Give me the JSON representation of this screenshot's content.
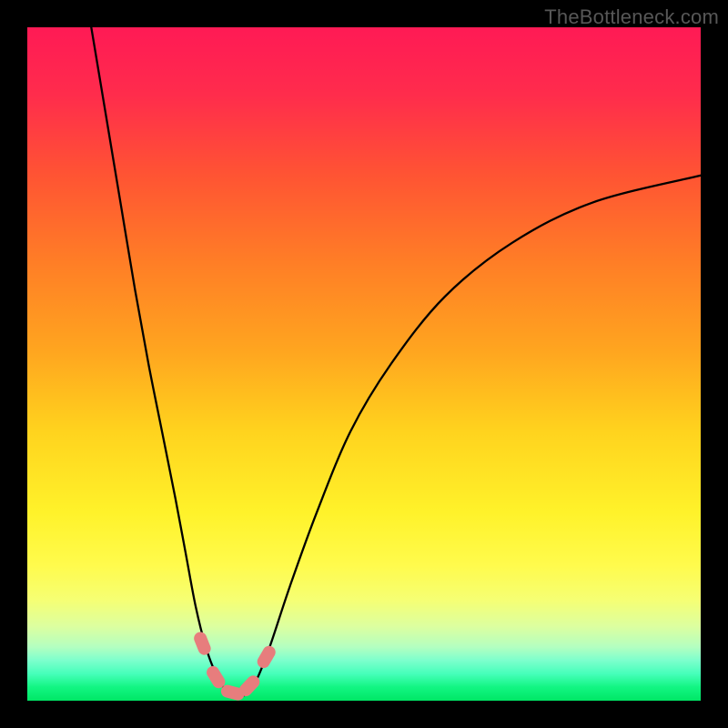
{
  "watermark": "TheBottleneck.com",
  "frame": {
    "inner_width": 740,
    "inner_height": 740,
    "border": 30
  },
  "gradient": {
    "stops": [
      {
        "pct": 0,
        "color": "#ff1a55"
      },
      {
        "pct": 10,
        "color": "#ff2c4c"
      },
      {
        "pct": 22,
        "color": "#ff5433"
      },
      {
        "pct": 35,
        "color": "#ff7e26"
      },
      {
        "pct": 48,
        "color": "#ffa51f"
      },
      {
        "pct": 60,
        "color": "#ffd31e"
      },
      {
        "pct": 72,
        "color": "#fff22a"
      },
      {
        "pct": 80,
        "color": "#fffb4d"
      },
      {
        "pct": 85,
        "color": "#f6ff73"
      },
      {
        "pct": 89,
        "color": "#dcffa0"
      },
      {
        "pct": 92,
        "color": "#b4ffc0"
      },
      {
        "pct": 94,
        "color": "#7dffcd"
      },
      {
        "pct": 96,
        "color": "#46ffba"
      },
      {
        "pct": 98,
        "color": "#12f582"
      },
      {
        "pct": 100,
        "color": "#00e765"
      }
    ]
  },
  "chart_data": {
    "type": "line",
    "title": "",
    "xlabel": "",
    "ylabel": "",
    "xlim": [
      0,
      100
    ],
    "ylim": [
      0,
      100
    ],
    "curve": {
      "points": [
        [
          9.5,
          100
        ],
        [
          12,
          85
        ],
        [
          14,
          73
        ],
        [
          16,
          61
        ],
        [
          18,
          50
        ],
        [
          20,
          40
        ],
        [
          22,
          30
        ],
        [
          23.5,
          22
        ],
        [
          25,
          14
        ],
        [
          26.5,
          8
        ],
        [
          28,
          4
        ],
        [
          29.5,
          1.5
        ],
        [
          31,
          0.6
        ],
        [
          32.5,
          1.0
        ],
        [
          34,
          3
        ],
        [
          36,
          8
        ],
        [
          39,
          17
        ],
        [
          43,
          28
        ],
        [
          48,
          40
        ],
        [
          54,
          50
        ],
        [
          62,
          60
        ],
        [
          72,
          68
        ],
        [
          84,
          74
        ],
        [
          100,
          78
        ]
      ]
    },
    "markers": {
      "color": "#e77d7d",
      "points": [
        [
          26.0,
          8.5
        ],
        [
          28.0,
          3.5
        ],
        [
          30.5,
          1.2
        ],
        [
          33.0,
          2.2
        ],
        [
          35.5,
          6.5
        ]
      ]
    }
  }
}
